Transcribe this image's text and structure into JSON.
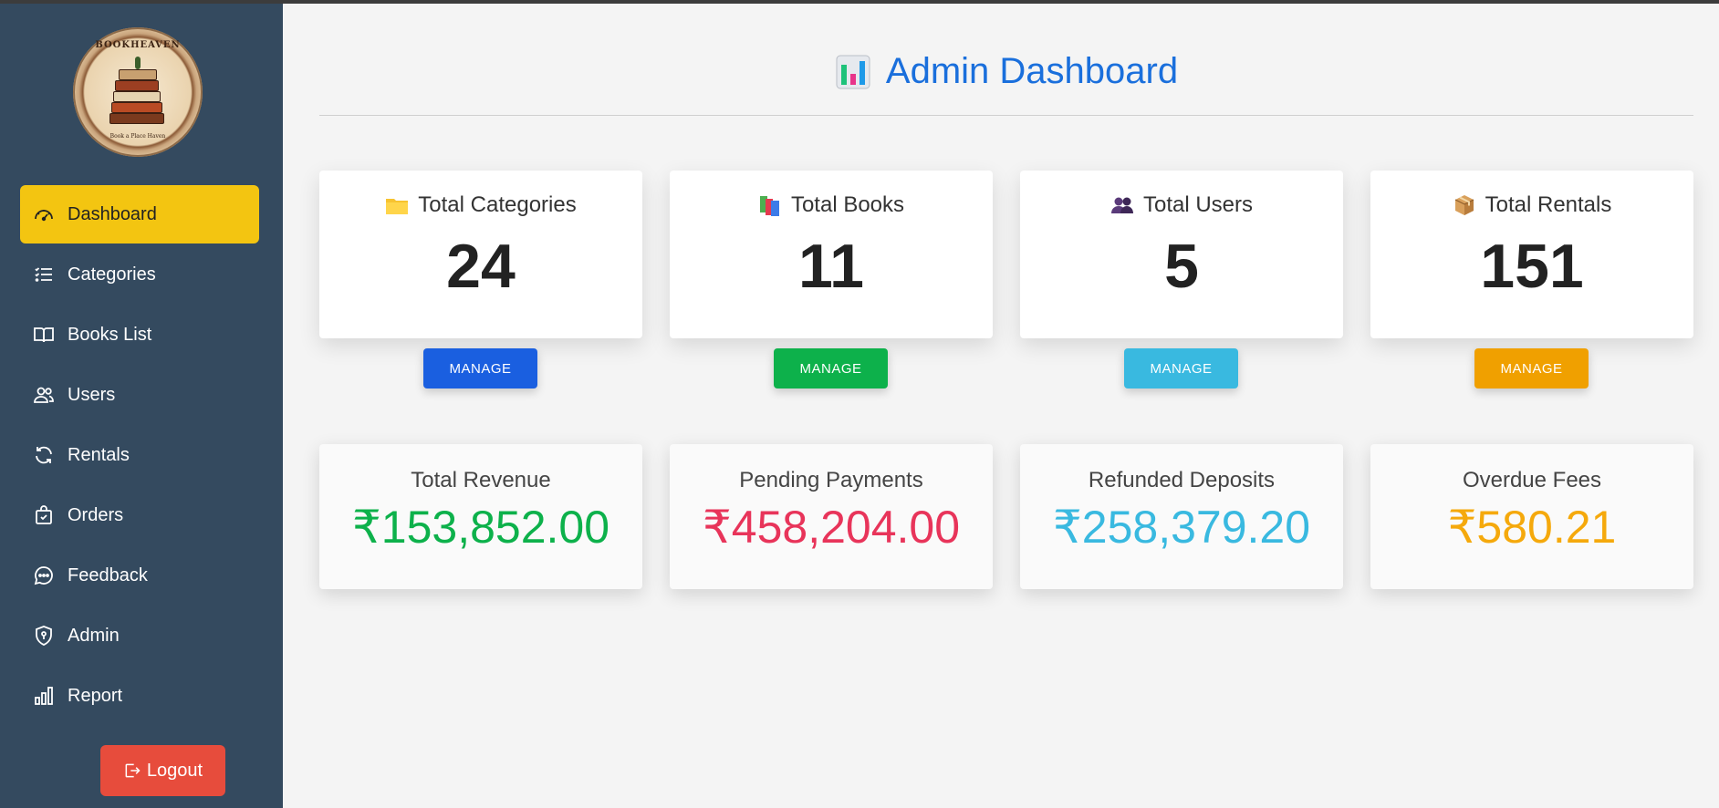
{
  "sidebar": {
    "logo": {
      "ring_text": "BOOKHEAVEN",
      "tagline": "Book a Place Haven"
    },
    "items": [
      {
        "label": "Dashboard",
        "icon": "speedometer-icon",
        "active": true
      },
      {
        "label": "Categories",
        "icon": "list-icon"
      },
      {
        "label": "Books List",
        "icon": "book-icon"
      },
      {
        "label": "Users",
        "icon": "users-icon"
      },
      {
        "label": "Rentals",
        "icon": "refresh-icon"
      },
      {
        "label": "Orders",
        "icon": "bag-icon"
      },
      {
        "label": "Feedback",
        "icon": "chat-icon"
      },
      {
        "label": "Admin",
        "icon": "shield-icon"
      },
      {
        "label": "Report",
        "icon": "bar-chart-icon"
      }
    ],
    "logout_label": "Logout"
  },
  "main": {
    "title": "Admin Dashboard",
    "stats": [
      {
        "label": "Total Categories",
        "value": "24",
        "icon": "folder-icon",
        "button": "MANAGE",
        "button_color": "#1a5fe0"
      },
      {
        "label": "Total Books",
        "value": "11",
        "icon": "books-icon",
        "button": "MANAGE",
        "button_color": "#0db14b"
      },
      {
        "label": "Total Users",
        "value": "5",
        "icon": "users-icon",
        "button": "MANAGE",
        "button_color": "#39b9e0"
      },
      {
        "label": "Total Rentals",
        "value": "151",
        "icon": "package-icon",
        "button": "MANAGE",
        "button_color": "#f0a000"
      }
    ],
    "finance": [
      {
        "label": "Total Revenue",
        "value": "₹153,852.00",
        "color": "#0db14b"
      },
      {
        "label": "Pending Payments",
        "value": "₹458,204.00",
        "color": "#e8345a"
      },
      {
        "label": "Refunded Deposits",
        "value": "₹258,379.20",
        "color": "#39b9e0"
      },
      {
        "label": "Overdue Fees",
        "value": "₹580.21",
        "color": "#f5a90c"
      }
    ]
  }
}
